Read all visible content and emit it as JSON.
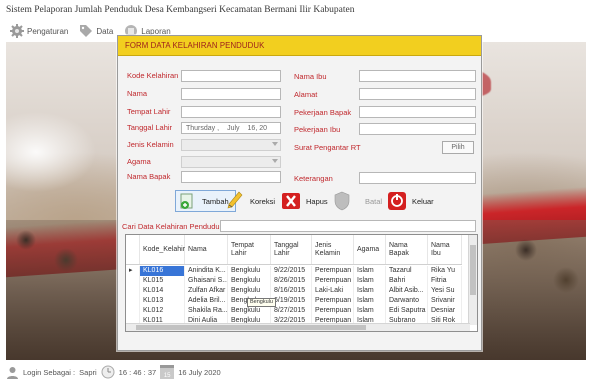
{
  "app": {
    "title": "Sistem Pelaporan Jumlah Penduduk Desa Kembangseri Kecamatan Bermani Ilir Kabupaten"
  },
  "menu": {
    "items": [
      {
        "label": "Pengaturan"
      },
      {
        "label": "Data"
      },
      {
        "label": "Laporan"
      }
    ]
  },
  "status": {
    "login_label": "Login Sebagai :",
    "user": "Sapri",
    "time": "16 : 46 : 37",
    "calendar_day": "15",
    "date": "16 July 2020"
  },
  "form": {
    "title": "FORM DATA KELAHIRAN PENDUDUK",
    "labels": {
      "kode": "Kode Kelahiran",
      "nama": "Nama",
      "tempat_lahir": "Tempat Lahir",
      "tanggal_lahir": "Tanggal Lahir",
      "jenis_kelamin": "Jenis Kelamin",
      "agama": "Agama",
      "nama_bapak": "Nama Bapak",
      "nama_ibu": "Nama Ibu",
      "alamat": "Alamat",
      "pekerjaan_bapak": "Pekerjaan Bapak",
      "pekerjaan_ibu": "Pekerjaan Ibu",
      "surat": "Surat Pengantar RT",
      "keterangan": "Keterangan"
    },
    "date_value": {
      "day_name": "Thursday ,",
      "month": "July",
      "day_year": "16, 20"
    },
    "pilih_label": "Pilih",
    "buttons": {
      "tambah": "Tambah",
      "koreksi": "Koreksi",
      "hapus": "Hapus",
      "batal": "Batal",
      "keluar": "Keluar"
    },
    "search_label": "Cari Data Kelahiran Penduduk",
    "table": {
      "columns": [
        "Kode_Kelahir",
        "Nama",
        "Tempat Lahir",
        "Tanggal Lahir",
        "Jenis Kelamin",
        "Agama",
        "Nama Bapak",
        "Nama Ibu"
      ],
      "rows": [
        [
          "KL016",
          "Anindita K...",
          "Bengkulu",
          "9/22/2015",
          "Perempuan",
          "Islam",
          "Tazarul",
          "Rika Yu"
        ],
        [
          "KL015",
          "Ghaisani S...",
          "Bengkulu",
          "8/26/2015",
          "Perempuan",
          "Islam",
          "Bahri",
          "Fitria"
        ],
        [
          "KL014",
          "Zulfan Afkar",
          "Bengkulu",
          "8/16/2015",
          "Laki-Laki",
          "Islam",
          "Albit Asib...",
          "Yesi Su"
        ],
        [
          "KL013",
          "Adelia Bril...",
          "Bengkulu",
          "6/19/2015",
          "Perempuan",
          "Islam",
          "Darwanto",
          "Srivanir"
        ],
        [
          "KL012",
          "Shakila Ra...",
          "Bengkulu",
          "8/27/2015",
          "Perempuan",
          "Islam",
          "Edi Saputra",
          "Desniar"
        ],
        [
          "KL011",
          "Dini Aulia",
          "Bengkulu",
          "3/22/2015",
          "Perempuan",
          "Islam",
          "Subrano",
          "Siti Rok"
        ]
      ],
      "tooltip": "Bengkulu",
      "row_marker": "▸"
    }
  },
  "colors": {
    "header": "#f2cf1f",
    "label": "#c0282d",
    "selection": "#3875d7"
  }
}
